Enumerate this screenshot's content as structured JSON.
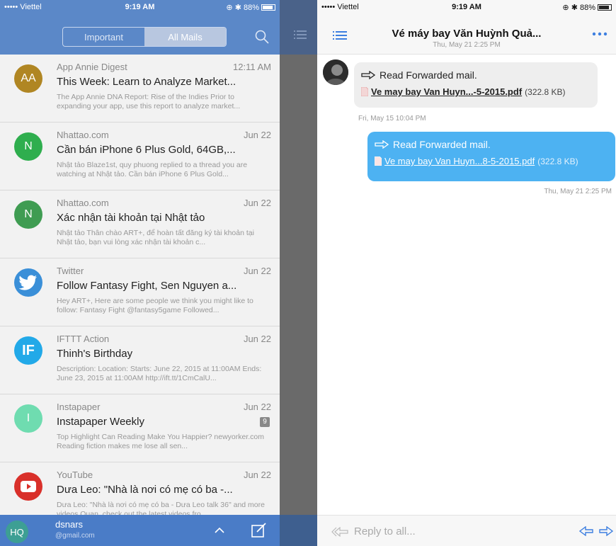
{
  "status_bar": {
    "carrier": "••••• Viettel",
    "time": "9:19 AM",
    "battery_left": "88%",
    "battery_right": "88%"
  },
  "left": {
    "tabs": [
      {
        "label": "Important",
        "active": false
      },
      {
        "label": "All Mails",
        "active": true
      }
    ],
    "mails": [
      {
        "initials": "AA",
        "color": "#b08623",
        "sender": "App Annie Digest",
        "date": "12:11 AM",
        "subject": "This Week: Learn to Analyze Market...",
        "preview": "The App Annie DNA Report: Rise of the Indies Prior to expanding your app, use this report to analyze market..."
      },
      {
        "initials": "N",
        "color": "#2fae4e",
        "sender": "Nhattao.com",
        "date": "Jun 22",
        "subject": "Cần bán iPhone 6 Plus Gold, 64GB,...",
        "preview": "Nhật tảo Blaze1st, quy phuong replied to a thread you are watching at Nhật tảo. Cần bán iPhone 6 Plus Gold..."
      },
      {
        "initials": "N",
        "color": "#3f9c52",
        "sender": "Nhattao.com",
        "date": "Jun 22",
        "subject": "Xác nhận tài khoản tại Nhật tảo",
        "preview": "Nhật tảo Thân chào ART+, để hoàn tất đăng ký tài khoản tại Nhật tảo, bạn vui lòng xác nhận tài khoản c..."
      },
      {
        "initials": "",
        "color": "#3a8fd8",
        "sender": "Twitter",
        "date": "Jun 22",
        "subject": "Follow Fantasy Fight, Sen Nguyen a...",
        "preview": "Hey ART+, Here are some people we think you might like to follow: Fantasy Fight @fantasy5game Followed..."
      },
      {
        "initials": "IF",
        "color": "#22a9e8",
        "sender": "IFTTT Action",
        "date": "Jun 22",
        "subject": "Thinh's Birthday",
        "preview": "Description: Location: Starts: June 22, 2015 at 11:00AM Ends: June 23, 2015 at 11:00AM http://ift.tt/1CmCalU..."
      },
      {
        "initials": "I",
        "color": "#6fdcb0",
        "sender": "Instapaper",
        "date": "Jun 22",
        "subject": "Instapaper Weekly",
        "badge": "9",
        "preview": "Top Highlight Can Reading Make You Happier? newyorker.com Reading fiction makes me lose all sen..."
      },
      {
        "initials": "",
        "color": "#d9302a",
        "sender": "YouTube",
        "date": "Jun 22",
        "subject": "Dưa Leo: \"Nhà là nơi có mẹ có ba -...",
        "preview": "Dưa Leo: \"Nhà là nơi có mẹ có ba - Dưa Leo talk 36\" and more videos Quan, check out the latest videos fro..."
      }
    ],
    "account": {
      "initials": "HQ",
      "name": "dsnars",
      "email": "@gmail.com"
    }
  },
  "right": {
    "title": "Vé máy bay Văn Huỳnh Quả...",
    "date": "Thu, May 21 2:25 PM",
    "messages": [
      {
        "direction": "in",
        "label": "Read Forwarded mail.",
        "attachment": "Ve may bay Van Huyn...-5-2015.pdf",
        "size": "(322.8 KB)",
        "time": "Fri, May 15 10:04 PM"
      },
      {
        "direction": "out",
        "label": "Read Forwarded mail.",
        "attachment": "Ve may bay Van Huyn...8-5-2015.pdf",
        "size": "(322.8 KB)",
        "time": "Thu, May 21 2:25 PM"
      }
    ],
    "reply_placeholder": "Reply to all..."
  },
  "colors": {
    "left_header": "#5b88c8",
    "left_bottom": "#4a7cc7",
    "accent_blue": "#3d7fe0",
    "outgoing_bubble": "#4db2f2"
  }
}
